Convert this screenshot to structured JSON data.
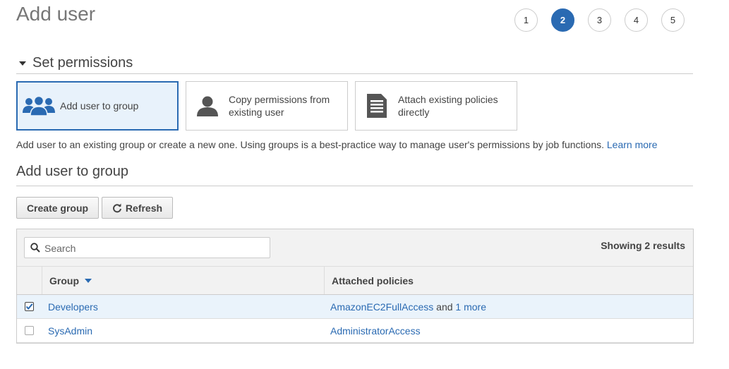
{
  "page": {
    "title": "Add user"
  },
  "steps": [
    {
      "label": "1",
      "active": false
    },
    {
      "label": "2",
      "active": true
    },
    {
      "label": "3",
      "active": false
    },
    {
      "label": "4",
      "active": false
    },
    {
      "label": "5",
      "active": false
    }
  ],
  "permissions": {
    "section_title": "Set permissions",
    "options": [
      {
        "label": "Add user to group",
        "icon": "users-group-icon",
        "selected": true
      },
      {
        "label_line1": "Copy permissions from",
        "label_line2": "existing user",
        "icon": "user-icon",
        "selected": false
      },
      {
        "label_line1": "Attach existing policies",
        "label_line2": "directly",
        "icon": "document-icon",
        "selected": false
      }
    ],
    "description": "Add user to an existing group or create a new one. Using groups is a best-practice way to manage user's permissions by job functions.",
    "learn_more": "Learn more"
  },
  "group_section": {
    "title": "Add user to group",
    "create_label": "Create group",
    "refresh_label": "Refresh",
    "search_placeholder": "Search",
    "results_text": "Showing 2 results",
    "columns": [
      "Group",
      "Attached policies"
    ],
    "rows": [
      {
        "checked": true,
        "group": "Developers",
        "policy": "AmazonEC2FullAccess",
        "policy_suffix": " and ",
        "more": "1 more"
      },
      {
        "checked": false,
        "group": "SysAdmin",
        "policy": "AdministratorAccess"
      }
    ]
  },
  "colors": {
    "accent": "#2a6ab2",
    "selected_bg": "#e8f2fb",
    "row_selected_bg": "#eaf3fb"
  }
}
